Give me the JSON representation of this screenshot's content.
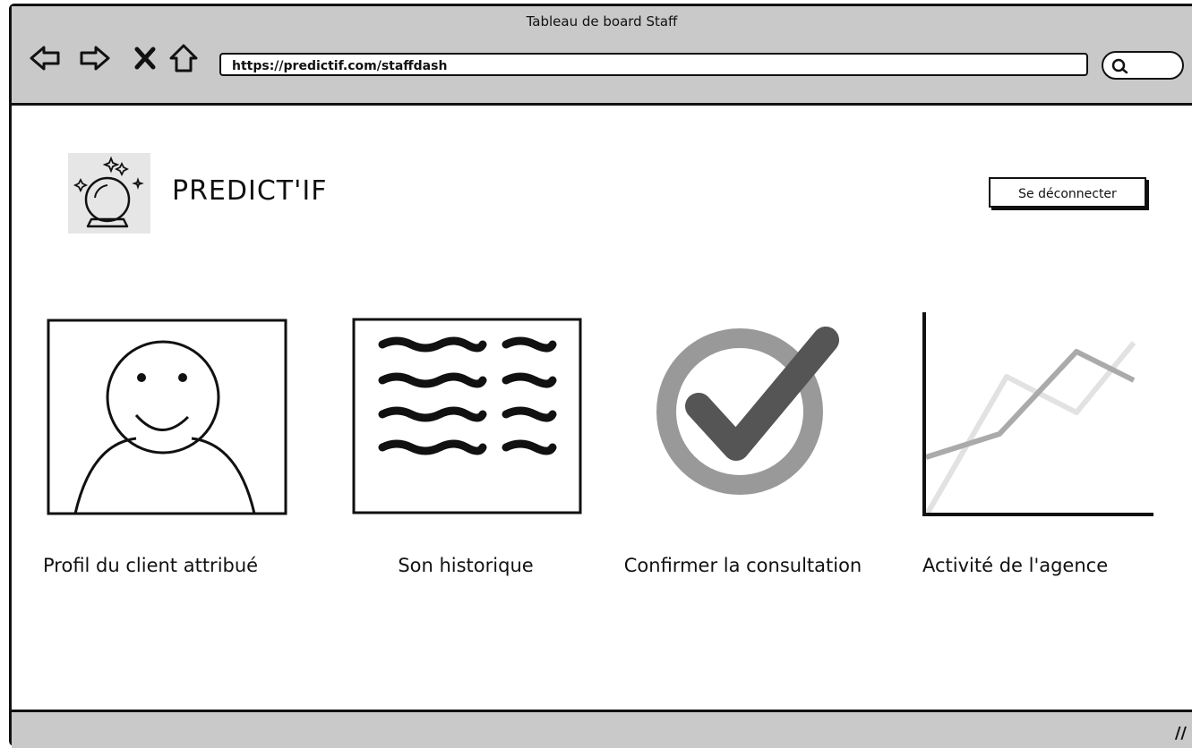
{
  "window": {
    "title": "Tableau de board Staff",
    "url": "https://predictif.com/staffdash"
  },
  "header": {
    "brand": "PREDICT'IF",
    "logout_label": "Se déconnecter"
  },
  "tiles": [
    {
      "label": "Profil du client attribué",
      "icon": "user-profile-icon"
    },
    {
      "label": "Son historique",
      "icon": "text-list-icon"
    },
    {
      "label": "Confirmer la consultation",
      "icon": "check-circle-icon"
    },
    {
      "label": "Activité de l'agence",
      "icon": "line-chart-icon"
    }
  ],
  "colors": {
    "chrome": "#c9c9c9",
    "ink": "#111111",
    "logo_bg": "#e6e6e6",
    "check_ring": "#999999",
    "check_mark": "#555555"
  }
}
